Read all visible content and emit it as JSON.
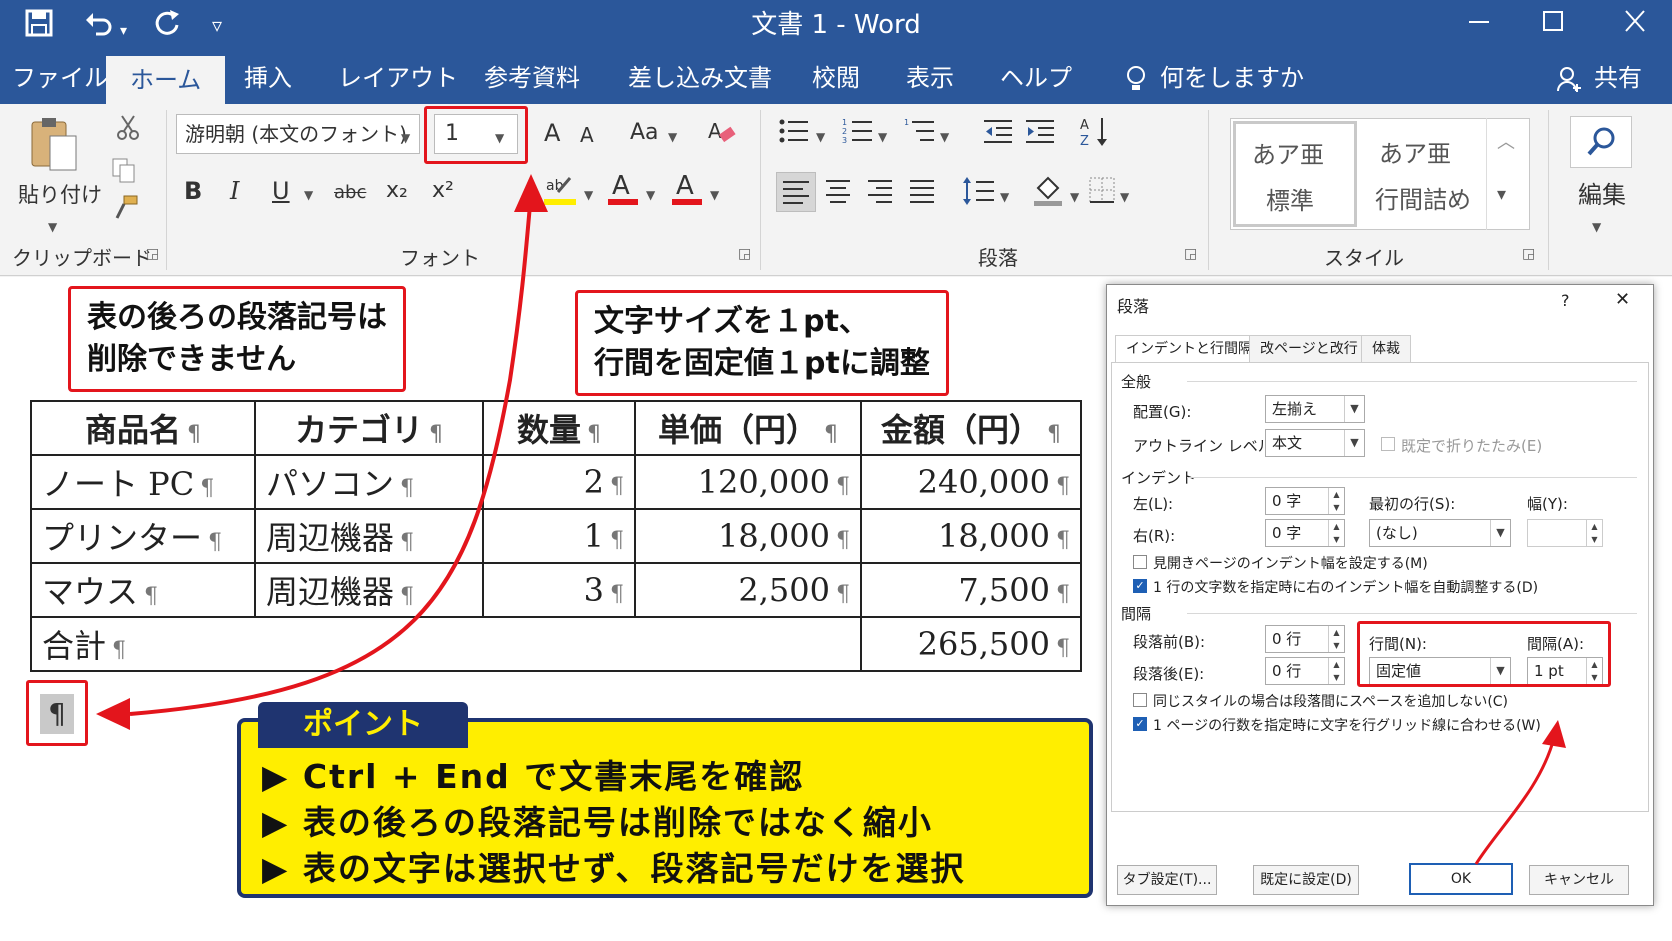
{
  "titlebar": {
    "doc_title": "文書 1  -  Word",
    "undo_dd": "▾",
    "customize": "▿"
  },
  "tabs": [
    "ファイル",
    "ホーム",
    "挿入",
    "レイアウト",
    "参考資料",
    "差し込み文書",
    "校閲",
    "表示",
    "ヘルプ",
    "何をしますか"
  ],
  "share": "共有",
  "ribbon": {
    "clipboard": {
      "paste": "貼り付け",
      "label": "クリップボード"
    },
    "font": {
      "name": "游明朝 (本文のフォント)",
      "size": "1",
      "grow": "A",
      "shrink": "A",
      "case": "Aa",
      "bold": "B",
      "italic": "I",
      "underline": "U",
      "strike": "abc",
      "subscript": "x₂",
      "superscript": "x²",
      "label": "フォント"
    },
    "paragraph": {
      "label": "段落"
    },
    "styles": {
      "sample": "あア亜",
      "items": [
        "標準",
        "行間詰め"
      ],
      "label": "スタイル"
    },
    "editing": {
      "label": "編集"
    }
  },
  "callouts": {
    "left": [
      "表の後ろの段落記号は",
      "削除できません"
    ],
    "right": [
      "文字サイズを１pt、",
      "行間を固定値１ptに調整"
    ]
  },
  "pilcrow": "¶",
  "table": {
    "headers": [
      "商品名",
      "カテゴリ",
      "数量",
      "単価（円）",
      "金額（円）"
    ],
    "rows": [
      [
        "ノート PC",
        "パソコン",
        "2",
        "120,000",
        "240,000"
      ],
      [
        "プリンター",
        "周辺機器",
        "1",
        "18,000",
        "18,000"
      ],
      [
        "マウス",
        "周辺機器",
        "3",
        "2,500",
        "7,500"
      ]
    ],
    "total_label": "合計",
    "total_value": "265,500"
  },
  "point": {
    "tag": "ポイント",
    "lines": [
      "▶ Ctrl + End で文書末尾を確認",
      "▶ 表の後ろの段落記号は削除ではなく縮小",
      "▶ 表の文字は選択せず、段落記号だけを選択"
    ]
  },
  "dialog": {
    "title": "段落",
    "help": "?",
    "close": "✕",
    "tabs": [
      "インデントと行間隔",
      "改ページと改行",
      "体裁"
    ],
    "general": {
      "heading": "全般",
      "alignment_label": "配置(G):",
      "alignment_value": "左揃え",
      "outline_label": "アウトライン レベル(O):",
      "outline_value": "本文",
      "collapse_label": "既定で折りたたみ(E)"
    },
    "indent": {
      "heading": "インデント",
      "left_label": "左(L):",
      "left_value": "0 字",
      "right_label": "右(R):",
      "right_value": "0 字",
      "first_label": "最初の行(S):",
      "first_value": "(なし)",
      "width_label": "幅(Y):",
      "width_value": "",
      "mirror_label": "見開きページのインデント幅を設定する(M)",
      "auto_label": "1 行の文字数を指定時に右のインデント幅を自動調整する(D)"
    },
    "spacing": {
      "heading": "間隔",
      "before_label": "段落前(B):",
      "before_value": "0 行",
      "after_label": "段落後(E):",
      "after_value": "0 行",
      "line_label": "行間(N):",
      "line_value": "固定値",
      "at_label": "間隔(A):",
      "at_value": "1 pt",
      "same_style_label": "同じスタイルの場合は段落間にスペースを追加しない(C)",
      "grid_label": "1 ページの行数を指定時に文字を行グリッド線に合わせる(W)"
    },
    "buttons": {
      "tabs": "タブ設定(T)...",
      "default": "既定に設定(D)",
      "ok": "OK",
      "cancel": "キャンセル"
    }
  },
  "colors": {
    "word_blue": "#2b579a",
    "callout_red": "#e3151c",
    "point_yellow": "#ffee00",
    "point_navy": "#1f3470"
  }
}
